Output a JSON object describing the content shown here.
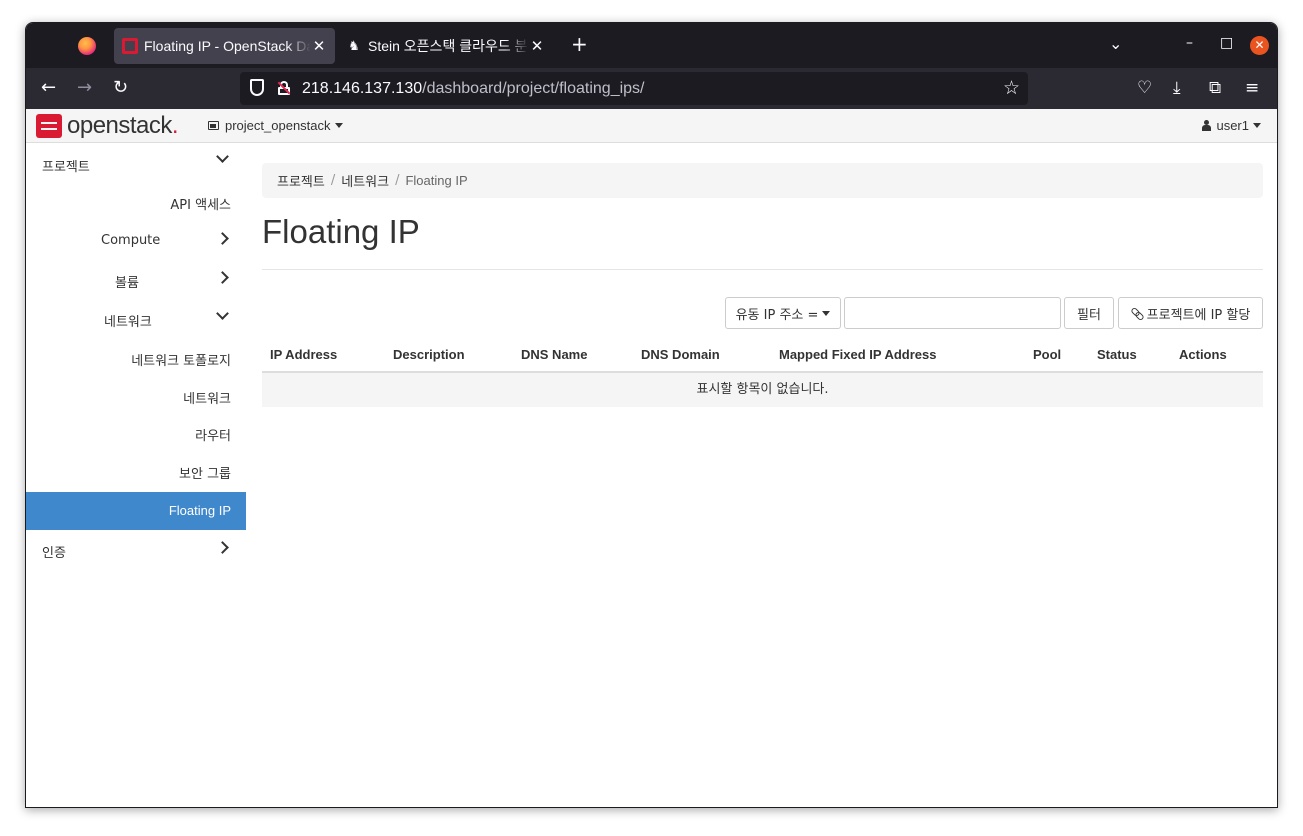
{
  "browser": {
    "tabs": [
      {
        "title": "Floating IP - OpenStack Dashboard",
        "active": true
      },
      {
        "title": "Stein 오픈스택 클라우드 분",
        "active": false
      }
    ],
    "new_tab_glyph": "+",
    "url": {
      "host": "218.146.137.130",
      "path": "/dashboard/project/floating_ips/"
    }
  },
  "header": {
    "logo_text": "openstack",
    "logo_dot": ".",
    "project": "project_openstack",
    "user": "user1"
  },
  "sidebar": {
    "items": [
      {
        "label": "프로젝트",
        "chevron": "down"
      },
      {
        "label": "API 액세스"
      },
      {
        "label": "Compute",
        "chevron": "right"
      },
      {
        "label": "볼륨",
        "chevron": "right"
      },
      {
        "label": "네트워크",
        "chevron": "down"
      },
      {
        "label": "네트워크 토폴로지"
      },
      {
        "label": "네트워크"
      },
      {
        "label": "라우터"
      },
      {
        "label": "보안 그룹"
      },
      {
        "label": "Floating IP",
        "active": true
      },
      {
        "label": "인증",
        "chevron": "right"
      }
    ]
  },
  "breadcrumb": [
    "프로젝트",
    "네트워크",
    "Floating IP"
  ],
  "page_title": "Floating IP",
  "filter": {
    "select_label": "유동 IP 주소 =",
    "input_value": "",
    "button_label": "필터"
  },
  "allocate_button_label": "프로젝트에 IP 할당",
  "table": {
    "columns": [
      "IP Address",
      "Description",
      "DNS Name",
      "DNS Domain",
      "Mapped Fixed IP Address",
      "Pool",
      "Status",
      "Actions"
    ],
    "empty_message": "표시할 항목이 없습니다."
  },
  "colors": {
    "accent": "#3f88cc",
    "brand_red": "#da1a32",
    "browser_dark": "#1c1b22"
  }
}
